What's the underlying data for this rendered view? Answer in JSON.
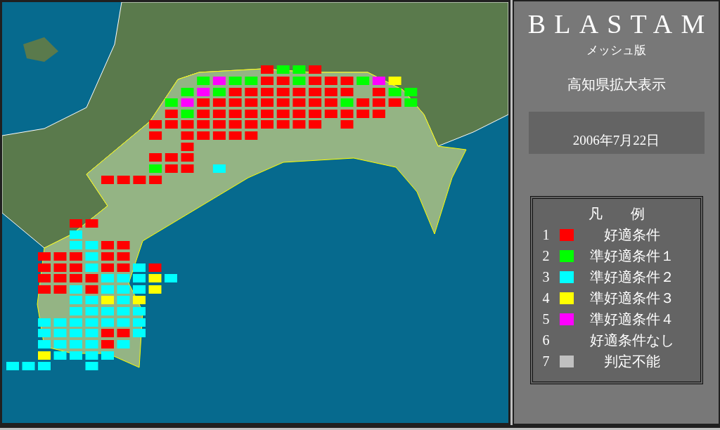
{
  "panel": {
    "title": "BLASTAM",
    "subtitle": "メッシュ版",
    "region_label": "高知県拡大表示",
    "date": "2006年7月22日"
  },
  "legend": {
    "title": "凡　　例",
    "items": [
      {
        "number": "1",
        "color": "#ff0000",
        "label": "好適条件"
      },
      {
        "number": "2",
        "color": "#00ff00",
        "label": "準好適条件１"
      },
      {
        "number": "3",
        "color": "#00ffff",
        "label": "準好適条件２"
      },
      {
        "number": "4",
        "color": "#ffff00",
        "label": "準好適条件３"
      },
      {
        "number": "5",
        "color": "#ff00ff",
        "label": "準好適条件４"
      },
      {
        "number": "6",
        "label": "好適条件なし"
      },
      {
        "number": "7",
        "color": "#c0c0c0",
        "label": "判定不能"
      }
    ]
  }
}
